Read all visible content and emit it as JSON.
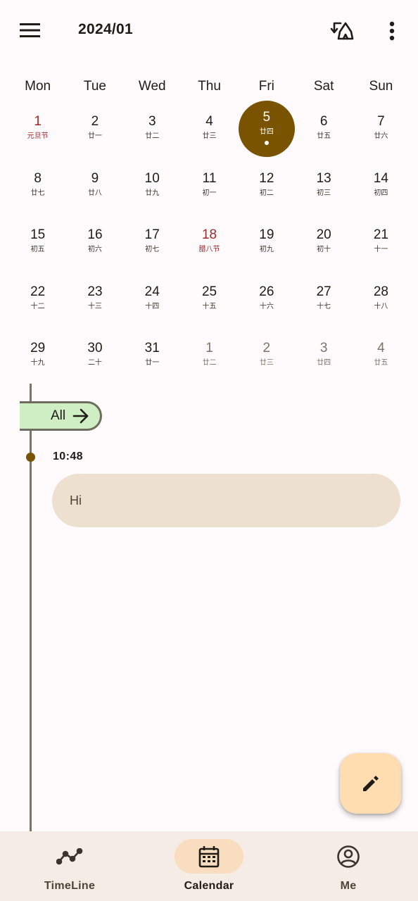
{
  "header": {
    "title": "2024/01"
  },
  "weekdays": [
    "Mon",
    "Tue",
    "Wed",
    "Thu",
    "Fri",
    "Sat",
    "Sun"
  ],
  "calendar": {
    "days": [
      {
        "num": "1",
        "lunar": "元旦节",
        "kind": "holiday"
      },
      {
        "num": "2",
        "lunar": "廿一",
        "kind": "normal"
      },
      {
        "num": "3",
        "lunar": "廿二",
        "kind": "normal"
      },
      {
        "num": "4",
        "lunar": "廿三",
        "kind": "normal"
      },
      {
        "num": "5",
        "lunar": "廿四",
        "kind": "selected"
      },
      {
        "num": "6",
        "lunar": "廿五",
        "kind": "normal"
      },
      {
        "num": "7",
        "lunar": "廿六",
        "kind": "normal"
      },
      {
        "num": "8",
        "lunar": "廿七",
        "kind": "normal"
      },
      {
        "num": "9",
        "lunar": "廿八",
        "kind": "normal"
      },
      {
        "num": "10",
        "lunar": "廿九",
        "kind": "normal"
      },
      {
        "num": "11",
        "lunar": "初一",
        "kind": "normal"
      },
      {
        "num": "12",
        "lunar": "初二",
        "kind": "normal"
      },
      {
        "num": "13",
        "lunar": "初三",
        "kind": "normal"
      },
      {
        "num": "14",
        "lunar": "初四",
        "kind": "normal"
      },
      {
        "num": "15",
        "lunar": "初五",
        "kind": "normal"
      },
      {
        "num": "16",
        "lunar": "初六",
        "kind": "normal"
      },
      {
        "num": "17",
        "lunar": "初七",
        "kind": "normal"
      },
      {
        "num": "18",
        "lunar": "腊八节",
        "kind": "holiday"
      },
      {
        "num": "19",
        "lunar": "初九",
        "kind": "normal"
      },
      {
        "num": "20",
        "lunar": "初十",
        "kind": "normal"
      },
      {
        "num": "21",
        "lunar": "十一",
        "kind": "normal"
      },
      {
        "num": "22",
        "lunar": "十二",
        "kind": "normal"
      },
      {
        "num": "23",
        "lunar": "十三",
        "kind": "normal"
      },
      {
        "num": "24",
        "lunar": "十四",
        "kind": "normal"
      },
      {
        "num": "25",
        "lunar": "十五",
        "kind": "normal"
      },
      {
        "num": "26",
        "lunar": "十六",
        "kind": "normal"
      },
      {
        "num": "27",
        "lunar": "十七",
        "kind": "normal"
      },
      {
        "num": "28",
        "lunar": "十八",
        "kind": "normal"
      },
      {
        "num": "29",
        "lunar": "十九",
        "kind": "normal"
      },
      {
        "num": "30",
        "lunar": "二十",
        "kind": "normal"
      },
      {
        "num": "31",
        "lunar": "廿一",
        "kind": "normal"
      },
      {
        "num": "1",
        "lunar": "廿二",
        "kind": "other"
      },
      {
        "num": "2",
        "lunar": "廿三",
        "kind": "other"
      },
      {
        "num": "3",
        "lunar": "廿四",
        "kind": "other"
      },
      {
        "num": "4",
        "lunar": "廿五",
        "kind": "other"
      }
    ]
  },
  "timeline": {
    "filter_label": "All",
    "entries": [
      {
        "time": "10:48",
        "text": "Hi"
      }
    ]
  },
  "bottom_nav": [
    {
      "label": "TimeLine",
      "icon": "timeline-icon",
      "active": false
    },
    {
      "label": "Calendar",
      "icon": "calendar-icon",
      "active": true
    },
    {
      "label": "Me",
      "icon": "account-circle-icon",
      "active": false
    }
  ],
  "colors": {
    "accent": "#7a5300",
    "holiday": "#a0282a",
    "chip": "#cfeec4",
    "bubble": "#ede0cf",
    "fab": "#ffddb0",
    "nav_bg": "#f5ede5",
    "nav_active": "#f8ddbf"
  },
  "icons": {
    "menu": "menu-icon",
    "sync": "sync-icon",
    "more": "more-vert-icon",
    "fab": "edit-pencil-icon",
    "arrow": "arrow-right-icon"
  }
}
